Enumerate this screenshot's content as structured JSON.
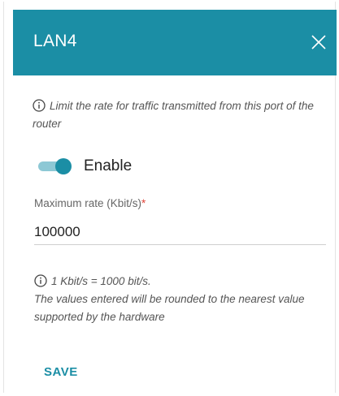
{
  "dialog": {
    "title": "LAN4",
    "close_icon": "close-icon"
  },
  "description": {
    "icon": "info-icon",
    "text": "Limit the rate for traffic transmitted from this port of the router"
  },
  "enable_toggle": {
    "label": "Enable",
    "state": "on",
    "accent_color": "#1b8ea5"
  },
  "max_rate": {
    "label": "Maximum rate (Kbit/s)",
    "required_marker": "*",
    "value": "100000"
  },
  "note": {
    "icon": "info-icon",
    "line1": "1 Kbit/s = 1000 bit/s.",
    "line2": "The values entered will be rounded to the nearest value supported by the hardware"
  },
  "actions": {
    "save_label": "SAVE"
  },
  "colors": {
    "header_bg": "#1b8ea5",
    "required": "#e0453a"
  }
}
